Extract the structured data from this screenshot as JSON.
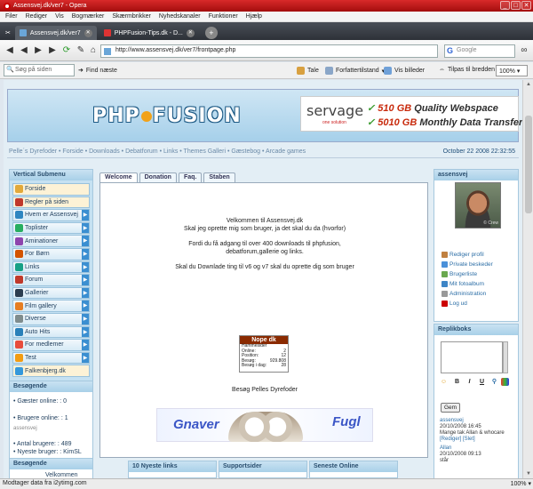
{
  "window": {
    "title": "Assensvej.dk/ver7 - Opera",
    "min": "_",
    "max": "□",
    "close": "✕"
  },
  "menu": [
    "Filer",
    "Rediger",
    "Vis",
    "Bogmærker",
    "Skærmbrikker",
    "Nyhedskanaler",
    "Funktioner",
    "Hjælp"
  ],
  "tabs": [
    {
      "label": "Assensvej.dk/ver7"
    },
    {
      "label": "PHPFusion-Tips.dk - D..."
    }
  ],
  "newtab": "+",
  "address": {
    "url": "http://www.assensvej.dk/ver7/frontpage.php",
    "search_placeholder": "Google"
  },
  "toolbar2": {
    "find_placeholder": "Søg på siden",
    "find_next": "Find næste",
    "tale": "Tale",
    "forfatter": "Forfattertilstand",
    "vis_billeder": "Vis billeder",
    "tilpas": "Tilpas til bredden",
    "zoom": "100%"
  },
  "site": {
    "servage_brand": "servage",
    "servage_sub": "one solution",
    "servage_l1_bold": "510 GB",
    "servage_l1": " Quality Webspace",
    "servage_l2_bold": "5010 GB",
    "servage_l2": " Monthly Data Transfer",
    "logo_a": "PHP",
    "logo_b": "FUSION",
    "navline": "Pelle´s Dyrefoder • Forside • Downloads • Debatforum • Links • Themes Galleri • Gæstebog • Arcade games",
    "date": "October 22 2008 22:32:55",
    "submenu_title": "Vertical Submenu",
    "submenu": [
      "Forside",
      "Regler på siden",
      "Hvem er Assensvej",
      "Toplister",
      "Aminationer",
      "For Børn",
      "Links",
      "Forum",
      "Gallerier",
      "Film gallery",
      "Diverse",
      "Auto Hits",
      "For medlemer",
      "Test",
      "Falkenbjerg.dk"
    ],
    "besog_title": "Besøgende",
    "besog": {
      "gaester": "• Gæster online: : 0",
      "brugere": "• Brugere online: : 1",
      "brugere_name": "assensvej",
      "antal": "• Antal brugere: : 489",
      "nyeste": "• Nyeste bruger: : KimSL"
    },
    "besog2_title": "Besøgende",
    "besog2_text": "Velkommen",
    "center_tabs": [
      "Welcome",
      "Donation",
      "Faq.",
      "Staben"
    ],
    "welcome": [
      "Velkommen til Assensvej.dk",
      "Skal jeg oprette mig som bruger, ja det skal du da (hvorfor)",
      "Fordi du få adgang til over 400 downloads til phpfusion,",
      "debatforum,gallerie og links.",
      "Skal du Downlade ting til v6 og v7 skal du oprette dig som bruger"
    ],
    "nope": {
      "title": "Nope dk",
      "rows": [
        [
          "Hammesider",
          ""
        ],
        [
          "Online:",
          "2"
        ],
        [
          "Position:",
          "12"
        ],
        [
          "Besøg:",
          "929.808"
        ],
        [
          "Besøg i dag:",
          "28"
        ]
      ]
    },
    "besog_pelle": "Besøg Pelles Dyrefoder",
    "banner_left": "Gnaver",
    "banner_right": "Fugl",
    "bottom_panels": [
      "10 Nyeste links",
      "Supportsider",
      "Seneste Online"
    ],
    "user_title": "assensvej",
    "avatar_tag": "© Crew",
    "user_links": [
      "Rediger profil",
      "Private beskeder",
      "Brugerliste",
      "Mit fotoalbum",
      "Administration",
      "Log ud"
    ],
    "replik_title": "Replikboks",
    "gem": "Gem",
    "fmt": [
      "B",
      "I",
      "U"
    ],
    "shouts": [
      {
        "who": "assensvej",
        "when": "20/10/2008 16:45",
        "text": "Mange tak Allan & whocare",
        "links": "[Rediger] [Slet]"
      },
      {
        "who": "Allan",
        "when": "20/10/2008 09:13",
        "text": "står "
      }
    ]
  },
  "status": {
    "text": "Modtager data fra i2ytimg.com",
    "zoom": "100%"
  }
}
